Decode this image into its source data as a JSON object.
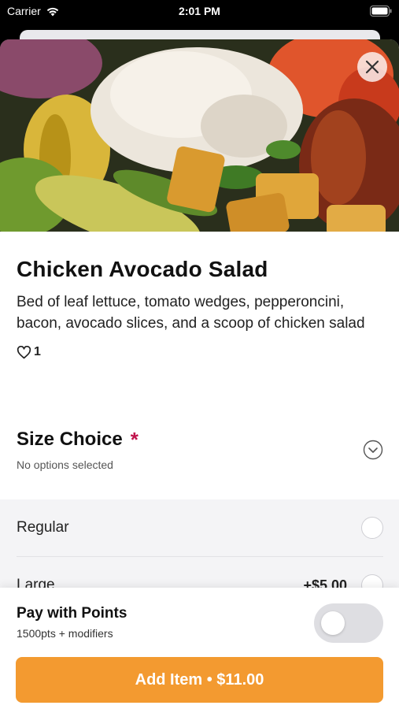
{
  "status": {
    "carrier": "Carrier",
    "time": "2:01 PM"
  },
  "item": {
    "image_icon": "salad-photo",
    "title": "Chicken Avocado Salad",
    "description": "Bed of leaf lettuce, tomato wedges, pepperoncini, bacon, avocado slices, and a scoop of chicken salad",
    "like_count": "1"
  },
  "size_choice": {
    "title": "Size Choice",
    "required_mark": "*",
    "status": "No options selected",
    "options": [
      {
        "label": "Regular",
        "price": ""
      },
      {
        "label": "Large",
        "price": "+$5.00"
      }
    ]
  },
  "footer": {
    "points_title": "Pay with Points",
    "points_sub": "1500pts + modifiers",
    "toggle_on": false,
    "add_button": "Add Item • $11.00"
  },
  "colors": {
    "accent": "#f39a30",
    "required": "#c0134c"
  }
}
